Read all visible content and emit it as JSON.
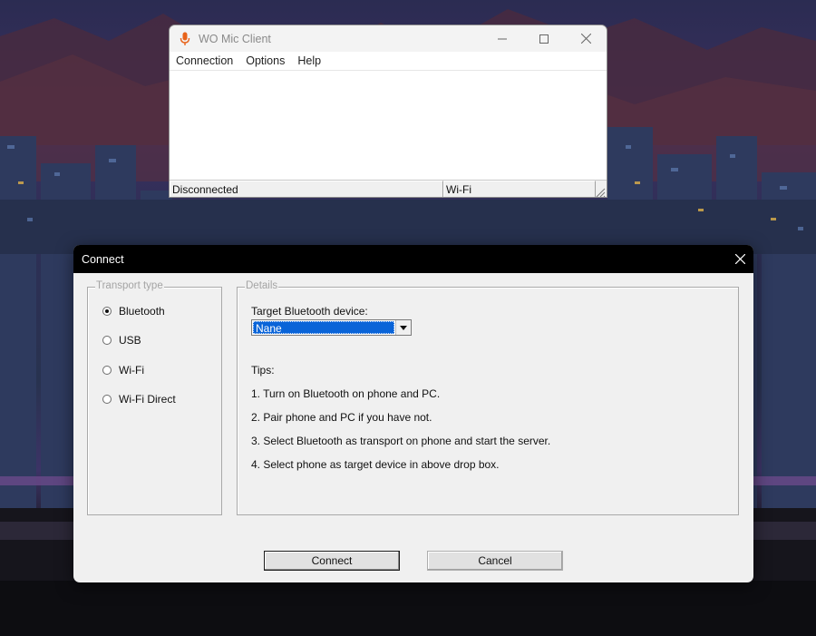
{
  "main_window": {
    "title": "WO Mic Client",
    "menu": [
      "Connection",
      "Options",
      "Help"
    ],
    "status": {
      "connection": "Disconnected",
      "transport": "Wi-Fi"
    }
  },
  "dialog": {
    "title": "Connect",
    "transport": {
      "legend": "Transport type",
      "options": [
        {
          "label": "Bluetooth",
          "checked": true
        },
        {
          "label": "USB",
          "checked": false
        },
        {
          "label": "Wi-Fi",
          "checked": false
        },
        {
          "label": "Wi-Fi Direct",
          "checked": false
        }
      ]
    },
    "details": {
      "legend": "Details",
      "target_label": "Target Bluetooth device:",
      "target_value": "Nane",
      "tips_heading": "Tips:",
      "tips": [
        "1. Turn on Bluetooth on phone and PC.",
        "2. Pair phone and PC if you have not.",
        "3. Select Bluetooth as transport on phone and start the server.",
        "4. Select phone as target device in above drop box."
      ]
    },
    "buttons": {
      "connect": "Connect",
      "cancel": "Cancel"
    }
  },
  "colors": {
    "selection": "#0a64d8",
    "mic_icon": "#e8631a",
    "dialog_title_bg": "#000000"
  }
}
